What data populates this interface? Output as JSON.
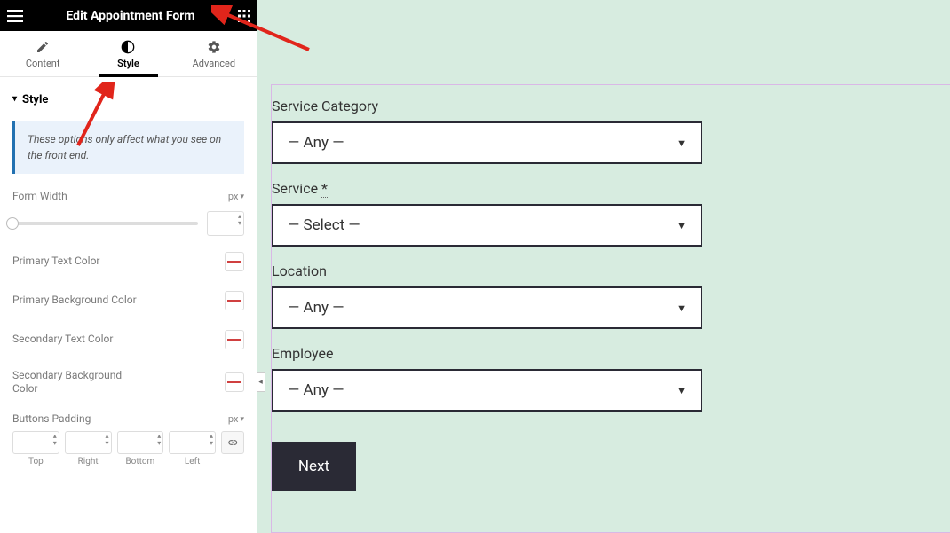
{
  "header": {
    "title": "Edit Appointment Form"
  },
  "tabs": {
    "content": "Content",
    "style": "Style",
    "advanced": "Advanced",
    "active": "Style"
  },
  "section": {
    "title": "Style"
  },
  "info": "These options only affect what you see on the front end.",
  "controls": {
    "form_width": {
      "label": "Form Width",
      "unit": "px",
      "value": ""
    },
    "primary_text_color": {
      "label": "Primary Text Color"
    },
    "primary_bg_color": {
      "label": "Primary Background Color"
    },
    "secondary_text_color": {
      "label": "Secondary Text Color"
    },
    "secondary_bg_color": {
      "label": "Secondary Background Color"
    },
    "buttons_padding": {
      "label": "Buttons Padding",
      "unit": "px",
      "sides": {
        "top": "Top",
        "right": "Right",
        "bottom": "Bottom",
        "left": "Left"
      }
    }
  },
  "form": {
    "fields": {
      "service_category": {
        "label": "Service Category",
        "value": "— Any —"
      },
      "service": {
        "label": "Service",
        "required_mark": "*",
        "value": "— Select —"
      },
      "location": {
        "label": "Location",
        "value": "— Any —"
      },
      "employee": {
        "label": "Employee",
        "value": "— Any —"
      }
    },
    "next": "Next"
  }
}
